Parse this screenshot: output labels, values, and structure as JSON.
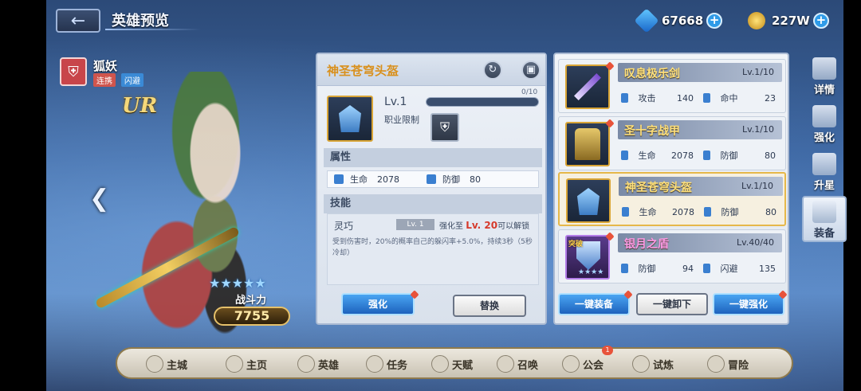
{
  "header": {
    "back_icon": "back-arrow-icon",
    "title": "英雄预览",
    "currencies": [
      {
        "icon": "diamond-icon",
        "value": "67668"
      },
      {
        "icon": "gold-coin-icon",
        "value": "227W"
      }
    ]
  },
  "hero": {
    "name": "狐妖",
    "tags": [
      "连携",
      "闪避"
    ],
    "rarity": "UR",
    "stars": "★★★★★",
    "power_label": "战斗力",
    "power_value": "7755"
  },
  "equip_detail": {
    "title": "神圣苍穹头盔",
    "level": "Lv.1",
    "progress": "0/10",
    "progress_fraction": 0.0,
    "job_limit_label": "职业限制",
    "attr_header": "属性",
    "attributes": [
      {
        "label": "生命",
        "value": "2078"
      },
      {
        "label": "防御",
        "value": "80"
      }
    ],
    "skill_header": "技能",
    "skill": {
      "name": "灵巧",
      "level": "Lv. 1",
      "unlock_prefix": "强化至",
      "unlock_level": "Lv. 20",
      "unlock_suffix": "可以解锁",
      "desc": "受到伤害时，20%的概率自己的躲闪率+5.0%，持续3秒（5秒冷却）"
    },
    "btn_enhance": "强化",
    "btn_replace": "替换"
  },
  "equip_list": [
    {
      "name": "叹息极乐剑",
      "level": "Lv.1/10",
      "stats": [
        {
          "label": "攻击",
          "value": "140"
        },
        {
          "label": "命中",
          "value": "23"
        }
      ]
    },
    {
      "name": "圣十字战甲",
      "level": "Lv.1/10",
      "stats": [
        {
          "label": "生命",
          "value": "2078"
        },
        {
          "label": "防御",
          "value": "80"
        }
      ]
    },
    {
      "name": "神圣苍穹头盔",
      "level": "Lv.1/10",
      "stats": [
        {
          "label": "生命",
          "value": "2078"
        },
        {
          "label": "防御",
          "value": "80"
        }
      ]
    },
    {
      "name": "银月之盾",
      "level": "Lv.40/40",
      "badge": "突破",
      "stats": [
        {
          "label": "防御",
          "value": "94"
        },
        {
          "label": "闪避",
          "value": "135"
        }
      ]
    }
  ],
  "list_buttons": {
    "equip_all": "一键装备",
    "unequip_all": "一键卸下",
    "enhance_all": "一键强化"
  },
  "side_tabs": [
    "详情",
    "强化",
    "升星",
    "装备"
  ],
  "bottom_nav": [
    {
      "label": "主城",
      "icon": "castle-icon"
    },
    {
      "label": "主页",
      "icon": "home-icon"
    },
    {
      "label": "英雄",
      "icon": "hero-icon"
    },
    {
      "label": "任务",
      "icon": "tasks-icon"
    },
    {
      "label": "天赋",
      "icon": "talent-icon"
    },
    {
      "label": "召唤",
      "icon": "summon-icon"
    },
    {
      "label": "公会",
      "icon": "guild-icon",
      "badge": "1"
    },
    {
      "label": "试炼",
      "icon": "trial-icon"
    },
    {
      "label": "冒险",
      "icon": "adventure-icon"
    }
  ]
}
